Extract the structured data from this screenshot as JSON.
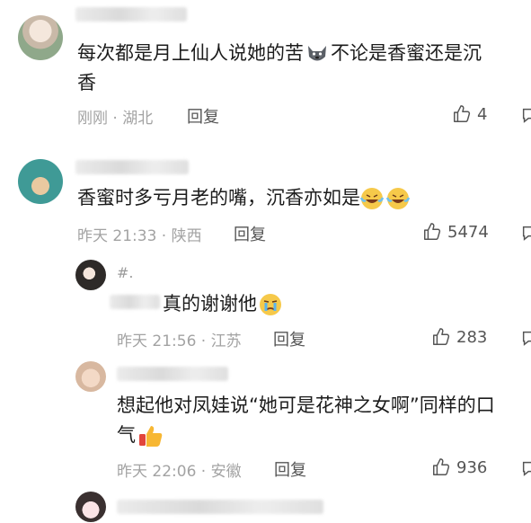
{
  "comments": [
    {
      "text_line1": "每次都是月上仙人说她的苦",
      "text_line1b": "不论是香蜜还是沉",
      "text_line2": "香",
      "meta": "刚刚 · 湖北",
      "reply_label": "回复",
      "likes": "4"
    },
    {
      "text": "香蜜时多亏月老的嘴，沉香亦如是",
      "meta": "昨天 21:33 · 陕西",
      "reply_label": "回复",
      "likes": "5474"
    }
  ],
  "replies": [
    {
      "handle": "#.",
      "text": "真的谢谢他",
      "meta": "昨天 21:56 · 江苏",
      "reply_label": "回复",
      "likes": "283"
    },
    {
      "text_line1": "想起他对凤娃说“她可是花神之女啊”同样的口",
      "text_line2": "气",
      "meta": "昨天 22:06 · 安徽",
      "reply_label": "回复",
      "likes": "936"
    }
  ],
  "icons": {
    "like": "thumbs-up-icon",
    "comment": "comment-icon"
  },
  "colors": {
    "meta": "#a3a3a3",
    "text": "#1c1c1c"
  }
}
